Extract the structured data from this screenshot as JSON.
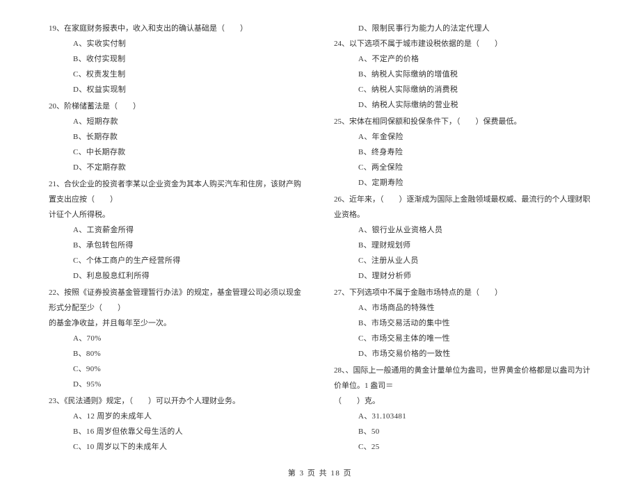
{
  "left": {
    "q19": {
      "stem": "19、在家庭财务报表中，收入和支出的确认基础是（　　）",
      "a": "A、实收实付制",
      "b": "B、收付实现制",
      "c": "C、权责发生制",
      "d": "D、权益实现制"
    },
    "q20": {
      "stem": "20、阶梯储蓄法是（　　）",
      "a": "A、短期存款",
      "b": "B、长期存款",
      "c": "C、中长期存款",
      "d": "D、不定期存款"
    },
    "q21": {
      "stem": "21、合伙企业的投资者李某以企业资金为其本人购买汽车和住房，该财产购置支出应按（　　）",
      "cont": "计征个人所得税。",
      "a": "A、工资薪金所得",
      "b": "B、承包转包所得",
      "c": "C、个体工商户的生产经营所得",
      "d": "D、利息股息红利所得"
    },
    "q22": {
      "stem": "22、按照《证券投资基金管理暂行办法》的规定，基金管理公司必须以现金形式分配至少（　　）",
      "cont": "的基金净收益，并且每年至少一次。",
      "a": "A、70%",
      "b": "B、80%",
      "c": "C、90%",
      "d": "D、95%"
    },
    "q23": {
      "stem": "23、《民法通则》规定，（　　）可以开办个人理财业务。",
      "a": "A、12 周岁的未成年人",
      "b": "B、16 周岁但依靠父母生活的人",
      "c": "C、10 周岁以下的未成年人"
    }
  },
  "right": {
    "q23d": "D、限制民事行为能力人的法定代理人",
    "q24": {
      "stem": "24、以下选项不属于城市建设税依据的是（　　）",
      "a": "A、不定产的价格",
      "b": "B、纳税人实际缴纳的增值税",
      "c": "C、纳税人实际缴纳的消费税",
      "d": "D、纳税人实际缴纳的营业税"
    },
    "q25": {
      "stem": "25、宋体在相同保额和投保条件下，（　　）保费最低。",
      "a": "A、年金保险",
      "b": "B、终身寿险",
      "c": "C、两全保险",
      "d": "D、定期寿险"
    },
    "q26": {
      "stem": "26、近年来，（　　）逐渐成为国际上金融领域最权威、最流行的个人理财职业资格。",
      "a": "A、银行业从业资格人员",
      "b": "B、理财规划师",
      "c": "C、注册从业人员",
      "d": "D、理财分析师"
    },
    "q27": {
      "stem": "27、下列选项中不属于金融市场特点的是（　　）",
      "a": "A、市场商品的特殊性",
      "b": "B、市场交易活动的集中性",
      "c": "C、市场交易主体的唯一性",
      "d": "D、市场交易价格的一致性"
    },
    "q28": {
      "stem": "28、、国际上一般通用的黄金计量单位为盎司，世界黄金价格都是以盎司为计价单位。1 盎司＝",
      "cont": "（　　）克。",
      "a": "A、31.103481",
      "b": "B、50",
      "c": "C、25"
    }
  },
  "footer": "第 3 页 共 18 页"
}
